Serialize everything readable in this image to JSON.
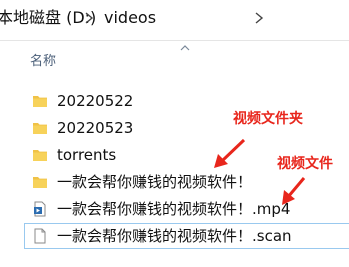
{
  "address": {
    "drive_label": "本地磁盘 (D:)",
    "folder_label": "videos",
    "separator_icon": "chevron-right-icon"
  },
  "column_header": {
    "name_label": "名称",
    "sort_icon": "chevron-up-icon"
  },
  "files": [
    {
      "name": "20220522",
      "icon": "folder-icon"
    },
    {
      "name": "20220523",
      "icon": "folder-icon"
    },
    {
      "name": "torrents",
      "icon": "folder-icon"
    },
    {
      "name": "一款会帮你赚钱的视频软件！",
      "icon": "folder-icon"
    },
    {
      "name": "一款会帮你赚钱的视频软件！.mp4",
      "icon": "video-file-icon"
    },
    {
      "name": "一款会帮你赚钱的视频软件！.scan",
      "icon": "blank-file-icon"
    }
  ],
  "annotations": {
    "folder_note": "视频文件夹",
    "file_note": "视频文件",
    "color": "#e8261c"
  },
  "colors": {
    "folder": "#f0c247",
    "selection_border": "#99c9ef",
    "header_text": "#4c607a"
  }
}
